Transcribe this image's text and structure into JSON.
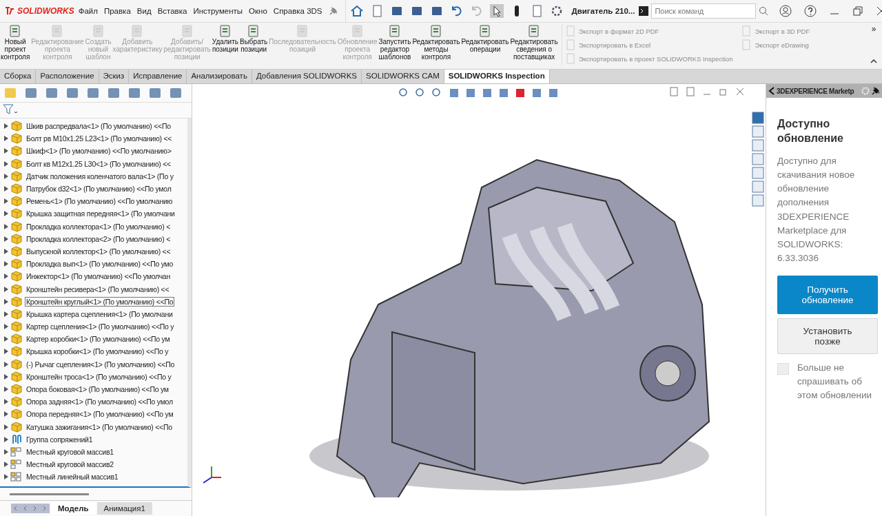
{
  "app": {
    "logo": "SOLIDWORKS",
    "menu": [
      "Файл",
      "Правка",
      "Вид",
      "Вставка",
      "Инструменты",
      "Окно",
      "Справка 3DS"
    ],
    "document_title": "Двигатель 210...",
    "search": {
      "placeholder": "Поиск команд"
    }
  },
  "ribbon": {
    "buttons": [
      {
        "label": "Новый проект контроля",
        "disabled": false
      },
      {
        "label": "Редактирование проекта контроля",
        "disabled": true
      },
      {
        "label": "Создать новый шаблон",
        "disabled": true
      },
      {
        "label": "Добавить характеристику",
        "disabled": true
      },
      {
        "label": "Добавить/редактировать позиции",
        "disabled": true
      },
      {
        "label": "Удалить позиции",
        "disabled": false
      },
      {
        "label": "Выбрать позиции",
        "disabled": false
      },
      {
        "label": "Последовательность позиций",
        "disabled": true
      },
      {
        "label": "Обновление проекта контроля",
        "disabled": true
      },
      {
        "label": "Запустить редактор шаблонов",
        "disabled": false
      },
      {
        "label": "Редактировать методы контроля",
        "disabled": false
      },
      {
        "label": "Редактировать операции",
        "disabled": false
      },
      {
        "label": "Редактировать сведения о поставщиках",
        "disabled": false
      }
    ],
    "export_items": [
      {
        "label": "Экспорт в формат 2D PDF",
        "disabled": true
      },
      {
        "label": "Экспортировать в Excel",
        "disabled": true
      },
      {
        "label": "Экспортировать в проект SOLIDWORKS Inspection",
        "disabled": true
      },
      {
        "label": "Экспорт в 3D PDF",
        "disabled": true
      },
      {
        "label": "Экспорт eDrawing",
        "disabled": true
      }
    ],
    "more": "»"
  },
  "tabs": [
    {
      "label": "Сборка",
      "selected": false
    },
    {
      "label": "Расположение",
      "selected": false
    },
    {
      "label": "Эскиз",
      "selected": false
    },
    {
      "label": "Исправление",
      "selected": false
    },
    {
      "label": "Анализировать",
      "selected": false
    },
    {
      "label": "Добавления SOLIDWORKS",
      "selected": false
    },
    {
      "label": "SOLIDWORKS CAM",
      "selected": false
    },
    {
      "label": "SOLIDWORKS Inspection",
      "selected": true
    }
  ],
  "tree": {
    "items": [
      {
        "kind": "part",
        "label": "Шкив распредвала<1> (По умолчанию) <<По",
        "selected": false
      },
      {
        "kind": "part",
        "label": "Болт рв M10x1.25 L23<1> (По умолчанию) <<",
        "selected": false
      },
      {
        "kind": "part",
        "label": "Шкиф<1> (По умолчанию) <<По умолчанию>",
        "selected": false
      },
      {
        "kind": "part",
        "label": "Болт кв M12x1.25 L30<1> (По умолчанию) <<",
        "selected": false
      },
      {
        "kind": "part",
        "label": "Датчик положения коленчатого вала<1> (По у",
        "selected": false
      },
      {
        "kind": "part",
        "label": "Патрубок d32<1> (По умолчанию) <<По умол",
        "selected": false
      },
      {
        "kind": "part",
        "label": "Ремень<1> (По умолчанию) <<По умолчанию",
        "selected": false
      },
      {
        "kind": "part",
        "label": "Крышка защитная передняя<1> (По умолчани",
        "selected": false
      },
      {
        "kind": "part",
        "label": "Прокладка коллектора<1> (По умолчанию) <",
        "selected": false
      },
      {
        "kind": "part",
        "label": "Прокладка коллектора<2> (По умолчанию) <",
        "selected": false
      },
      {
        "kind": "part",
        "label": "Выпускной коллектор<1> (По умолчанию) <<",
        "selected": false
      },
      {
        "kind": "part",
        "label": "Прокладка вып<1> (По умолчанию) <<По умо",
        "selected": false
      },
      {
        "kind": "part",
        "label": "Инжектор<1> (По умолчанию) <<По умолчан",
        "selected": false
      },
      {
        "kind": "part",
        "label": "Кронштейн ресивера<1> (По умолчанию) <<",
        "selected": false
      },
      {
        "kind": "part",
        "label": "Кронштейн круглый<1> (По умолчанию) <<По",
        "selected": true
      },
      {
        "kind": "part",
        "label": "Крышка картера сцепления<1> (По умолчани",
        "selected": false
      },
      {
        "kind": "part",
        "label": "Картер сцепления<1> (По умолчанию) <<По у",
        "selected": false
      },
      {
        "kind": "part",
        "label": "Картер коробки<1> (По умолчанию) <<По ум",
        "selected": false
      },
      {
        "kind": "part",
        "label": "Крышка коробки<1> (По умолчанию) <<По у",
        "selected": false
      },
      {
        "kind": "part",
        "label": "(-) Рычаг сцепления<1> (По умолчанию) <<По",
        "selected": false
      },
      {
        "kind": "part",
        "label": "Кронштейн троса<1> (По умолчанию) <<По у",
        "selected": false
      },
      {
        "kind": "part",
        "label": "Опора боковая<1> (По умолчанию) <<По ум",
        "selected": false
      },
      {
        "kind": "part",
        "label": "Опора задняя<1> (По умолчанию) <<По умол",
        "selected": false
      },
      {
        "kind": "part",
        "label": "Опора передняя<1> (По умолчанию) <<По ум",
        "selected": false
      },
      {
        "kind": "part",
        "label": "Катушка зажигания<1> (По умолчанию) <<По",
        "selected": false
      },
      {
        "kind": "mates",
        "label": "Группа сопряжений1",
        "selected": false
      },
      {
        "kind": "circular",
        "label": "Местный круговой массив1",
        "selected": false
      },
      {
        "kind": "circular",
        "label": "Местный круговой массив2",
        "selected": false
      },
      {
        "kind": "linear",
        "label": "Местный линейный массив1",
        "selected": false
      }
    ],
    "bottom_tabs": [
      {
        "label": "Модель",
        "selected": true
      },
      {
        "label": "Анимация1",
        "selected": false
      }
    ]
  },
  "task_pane": {
    "header": "3DEXPERIENCE Marketp",
    "title": "Доступно обновление",
    "message": "Доступно для скачивания новое обновление дополнения 3DEXPERIENCE Marketplace для SOLIDWORKS: 6.33.3036",
    "primary_button": "Получить обновление",
    "secondary_button": "Установить позже",
    "dont_ask": {
      "label": "Больше не спрашивать об этом обновлении",
      "checked": false
    }
  }
}
